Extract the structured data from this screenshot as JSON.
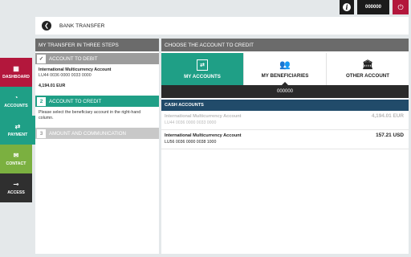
{
  "topbar": {
    "info_icon": "i",
    "user_label": "000000",
    "power_icon": "⏻"
  },
  "header": {
    "back_icon": "❮",
    "title": "BANK TRANSFER"
  },
  "sidebar": {
    "items": [
      {
        "label": "DASHBOARD",
        "icon": "▦"
      },
      {
        "label": "ACCOUNTS",
        "icon": "◔"
      },
      {
        "label": "PAYMENT",
        "icon": "⇄"
      },
      {
        "label": "CONTACT",
        "icon": "✉"
      },
      {
        "label": "ACCESS",
        "icon": "⊸"
      }
    ]
  },
  "steps": {
    "title": "MY TRANSFER IN THREE STEPS",
    "step1": {
      "mark": "✓",
      "label": "ACCOUNT TO DEBIT",
      "account_name": "International Multicurrency Account",
      "account_number": "LU44 0036 0000 0033 0000",
      "balance": "4,194.01 EUR"
    },
    "step2": {
      "mark": "2",
      "label": "ACCOUNT TO CREDIT",
      "hint": "Please select the beneficiary account in the right-hand column."
    },
    "step3": {
      "mark": "3",
      "label": "AMOUNT AND COMMUNICATION"
    }
  },
  "choose": {
    "title": "CHOOSE THE ACCOUNT TO CREDIT",
    "tabs": [
      {
        "label": "MY ACCOUNTS",
        "icon": "⇄"
      },
      {
        "label": "MY BENEFICIARIES",
        "icon": "👥"
      },
      {
        "label": "OTHER ACCOUNT",
        "icon": "🏛"
      }
    ],
    "selected": "000000",
    "section": "CASH ACCOUNTS",
    "accounts": [
      {
        "name": "International Multicurrency Account",
        "number": "LU44 0036 0000 0033 0000",
        "balance": "4,194.01 EUR"
      },
      {
        "name": "International Multicurrency Account",
        "number": "LU56 0036 0000 0038 1000",
        "balance": "157.21 USD"
      }
    ]
  }
}
